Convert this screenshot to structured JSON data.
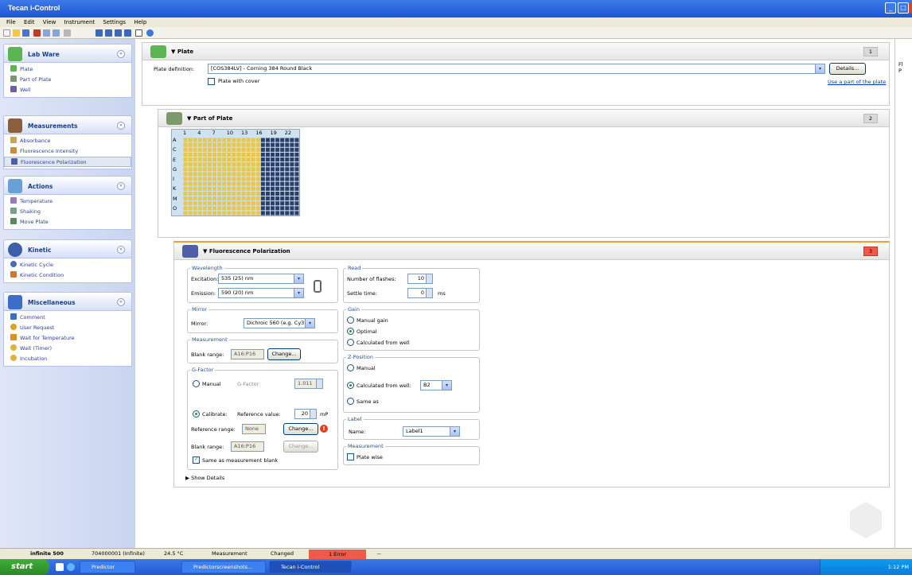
{
  "window": {
    "title": "Tecan i-Control"
  },
  "menu": [
    "File",
    "Edit",
    "View",
    "Instrument",
    "Settings",
    "Help"
  ],
  "sidebar": {
    "groups": [
      {
        "title": "Lab Ware",
        "items": [
          "Plate",
          "Part of Plate",
          "Well"
        ]
      },
      {
        "title": "Measurements",
        "items": [
          "Absorbance",
          "Fluorescence Intensity",
          "Fluorescence Polarization"
        ]
      },
      {
        "title": "Actions",
        "items": [
          "Temperature",
          "Shaking",
          "Move Plate"
        ]
      },
      {
        "title": "Kinetic",
        "items": [
          "Kinetic Cycle",
          "Kinetic Condition"
        ]
      },
      {
        "title": "Miscellaneous",
        "items": [
          "Comment",
          "User Request",
          "Wait for Temperature",
          "Wait (Timer)",
          "Incubation"
        ]
      }
    ]
  },
  "plate": {
    "title": "Plate",
    "num": "1",
    "def_label": "Plate definition:",
    "def_value": "[COS384LV] - Corning 384 Round Black",
    "details": "Details...",
    "cover_label": "Plate with cover",
    "part_link": "Use a part of the plate"
  },
  "part": {
    "title": "Part of Plate",
    "num": "2",
    "cols": [
      "1",
      "4",
      "7",
      "10",
      "13",
      "16",
      "19",
      "22"
    ],
    "rows": [
      "A",
      "C",
      "E",
      "G",
      "I",
      "K",
      "M",
      "O"
    ]
  },
  "fp": {
    "title": "Fluorescence Polarization",
    "num": "3",
    "wavelength": {
      "title": "Wavelength",
      "exc_label": "Excitation:",
      "exc_value": "535 (25) nm",
      "em_label": "Emission:",
      "em_value": "590 (20) nm"
    },
    "mirror": {
      "title": "Mirror",
      "label": "Mirror:",
      "value": "Dichroic 560 (e.g. Cy3)"
    },
    "measurement": {
      "title": "Measurement",
      "blank_label": "Blank range:",
      "blank_value": "A16:P16",
      "change": "Change..."
    },
    "gfactor": {
      "title": "G-Factor",
      "manual": "Manual",
      "gf_label": "G-Factor:",
      "gf_value": "1.011",
      "calibrate": "Calibrate:",
      "ref_label": "Reference value:",
      "ref_value": "20",
      "ref_unit": "mP",
      "refrange_label": "Reference range:",
      "refrange_value": "None",
      "change": "Change...",
      "blank_label": "Blank range:",
      "blank_value": "A16:P16",
      "change2": "Change...",
      "same_label": "Same as measurement blank"
    },
    "read": {
      "title": "Read",
      "flashes_label": "Number of flashes:",
      "flashes_value": "10",
      "settle_label": "Settle time:",
      "settle_value": "0",
      "settle_unit": "ms"
    },
    "gain": {
      "title": "Gain",
      "manual": "Manual gain",
      "optimal": "Optimal",
      "calc": "Calculated from well"
    },
    "zpos": {
      "title": "Z-Position",
      "manual": "Manual",
      "calc": "Calculated from well:",
      "calc_value": "B2",
      "same": "Same as"
    },
    "label": {
      "title": "Label",
      "name_label": "Name:",
      "name_value": "Label1"
    },
    "meas2": {
      "title": "Measurement",
      "plate_wise": "Plate wise"
    },
    "show_details": "Show Details"
  },
  "rightpane": {
    "text": "Fl P"
  },
  "status": {
    "instrument": "infinite 500",
    "serial": "704000001 (Infinite)",
    "temp": "24.5 °C",
    "mode": "Measurement",
    "state": "Changed",
    "error": "1 Error",
    "dash": "--"
  },
  "taskbar": {
    "start": "start",
    "items": [
      "Predictor",
      "Predictorscreenshots...",
      "Tecan i-Control"
    ],
    "clock": "1:12 PM"
  },
  "colors": {
    "accent": "#f05a46",
    "titlebar": "#1a56d6",
    "well": "#e8c84a",
    "wellsel": "#2b3f6b"
  }
}
